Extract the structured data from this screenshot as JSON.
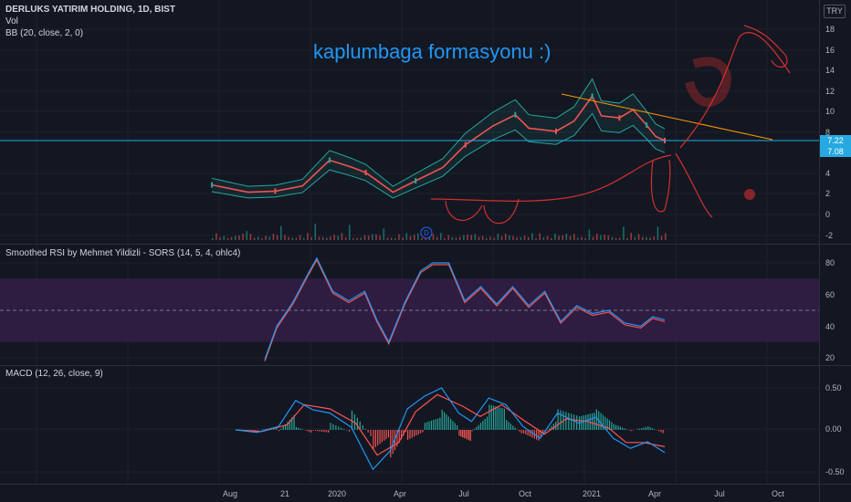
{
  "header": {
    "symbol_line": "DERLUKS YATIRIM HOLDING, 1D, BIST",
    "vol_label": "Vol",
    "bb_label": "BB (20, close, 2, 0)",
    "currency": "TRY"
  },
  "annotation_text": "kaplumbaga formasyonu :)",
  "price_tags": [
    "7.22",
    "7.08"
  ],
  "rsi_title": "Smoothed RSI by Mehmet Yildizli - SORS (14, 5, 4, ohlc4)",
  "macd_title": "MACD (12, 26, close, 9)",
  "event_marker": "D",
  "colors": {
    "background": "#131722",
    "up": "#26a69a",
    "down": "#ef5350",
    "bb_band": "#26a69a",
    "rsi_zone": "#3b1f4e",
    "macd_line": "#2196f3",
    "signal_line": "#ff5252",
    "drawing": "#d32f2f",
    "trendline": "#ff9800",
    "price_line": "#26a9e1"
  },
  "chart_data": [
    {
      "type": "line",
      "title": "DERLUKS YATIRIM HOLDING, 1D, BIST",
      "x": [
        "Aug",
        "21",
        "2020",
        "Apr",
        "Jul",
        "Oct",
        "2021",
        "Apr",
        "Jul",
        "Oct"
      ],
      "y_ticks": [
        18,
        16,
        14,
        12,
        10,
        8,
        4,
        2,
        0,
        -2
      ],
      "ylim": [
        -2.4,
        19
      ],
      "series": [
        {
          "name": "Price",
          "values": [
            {
              "t": 0.0,
              "v": 2.9
            },
            {
              "t": 0.08,
              "v": 2.2
            },
            {
              "t": 0.14,
              "v": 2.3
            },
            {
              "t": 0.2,
              "v": 2.8
            },
            {
              "t": 0.26,
              "v": 5.3
            },
            {
              "t": 0.31,
              "v": 4.6
            },
            {
              "t": 0.34,
              "v": 4.1
            },
            {
              "t": 0.4,
              "v": 2.2
            },
            {
              "t": 0.45,
              "v": 3.3
            },
            {
              "t": 0.51,
              "v": 4.6
            },
            {
              "t": 0.56,
              "v": 6.8
            },
            {
              "t": 0.62,
              "v": 8.6
            },
            {
              "t": 0.67,
              "v": 9.7
            },
            {
              "t": 0.7,
              "v": 8.4
            },
            {
              "t": 0.76,
              "v": 8.1
            },
            {
              "t": 0.8,
              "v": 9.1
            },
            {
              "t": 0.84,
              "v": 11.5
            },
            {
              "t": 0.86,
              "v": 9.6
            },
            {
              "t": 0.9,
              "v": 9.4
            },
            {
              "t": 0.93,
              "v": 10.2
            },
            {
              "t": 0.96,
              "v": 8.7
            },
            {
              "t": 0.98,
              "v": 7.6
            },
            {
              "t": 1.0,
              "v": 7.2
            }
          ]
        }
      ]
    },
    {
      "type": "line",
      "title": "Smoothed RSI by Mehmet Yildizli - SORS (14, 5, 4, ohlc4)",
      "y_ticks": [
        80,
        60,
        40,
        20
      ],
      "ylim": [
        18,
        85
      ],
      "zone": [
        30,
        70
      ],
      "midline": 50,
      "series": [
        {
          "name": "RSI",
          "values": [
            {
              "t": 0.0,
              "v": 19
            },
            {
              "t": 0.03,
              "v": 40
            },
            {
              "t": 0.07,
              "v": 55
            },
            {
              "t": 0.11,
              "v": 74
            },
            {
              "t": 0.13,
              "v": 83
            },
            {
              "t": 0.17,
              "v": 62
            },
            {
              "t": 0.21,
              "v": 56
            },
            {
              "t": 0.25,
              "v": 62
            },
            {
              "t": 0.28,
              "v": 44
            },
            {
              "t": 0.31,
              "v": 30
            },
            {
              "t": 0.35,
              "v": 55
            },
            {
              "t": 0.39,
              "v": 75
            },
            {
              "t": 0.42,
              "v": 80
            },
            {
              "t": 0.46,
              "v": 80
            },
            {
              "t": 0.5,
              "v": 56
            },
            {
              "t": 0.54,
              "v": 65
            },
            {
              "t": 0.58,
              "v": 54
            },
            {
              "t": 0.62,
              "v": 65
            },
            {
              "t": 0.66,
              "v": 53
            },
            {
              "t": 0.7,
              "v": 62
            },
            {
              "t": 0.74,
              "v": 43
            },
            {
              "t": 0.78,
              "v": 53
            },
            {
              "t": 0.82,
              "v": 48
            },
            {
              "t": 0.86,
              "v": 50
            },
            {
              "t": 0.9,
              "v": 42
            },
            {
              "t": 0.94,
              "v": 40
            },
            {
              "t": 0.97,
              "v": 46
            },
            {
              "t": 1.0,
              "v": 44
            }
          ]
        }
      ]
    },
    {
      "type": "line",
      "title": "MACD (12, 26, close, 9)",
      "y_ticks": [
        0.5,
        0.0,
        -0.5
      ],
      "y_tick_labels": [
        "0.50",
        "0.00",
        "-0.50"
      ],
      "ylim": [
        -0.55,
        0.62
      ],
      "series": [
        {
          "name": "MACD",
          "values": [
            {
              "t": 0.0,
              "v": 0.0
            },
            {
              "t": 0.05,
              "v": -0.03
            },
            {
              "t": 0.1,
              "v": 0.04
            },
            {
              "t": 0.14,
              "v": 0.35
            },
            {
              "t": 0.18,
              "v": 0.24
            },
            {
              "t": 0.22,
              "v": 0.2
            },
            {
              "t": 0.27,
              "v": 0.03
            },
            {
              "t": 0.32,
              "v": -0.47
            },
            {
              "t": 0.36,
              "v": -0.25
            },
            {
              "t": 0.4,
              "v": 0.25
            },
            {
              "t": 0.44,
              "v": 0.4
            },
            {
              "t": 0.48,
              "v": 0.5
            },
            {
              "t": 0.52,
              "v": 0.2
            },
            {
              "t": 0.55,
              "v": 0.1
            },
            {
              "t": 0.59,
              "v": 0.38
            },
            {
              "t": 0.63,
              "v": 0.3
            },
            {
              "t": 0.67,
              "v": 0.04
            },
            {
              "t": 0.71,
              "v": -0.1
            },
            {
              "t": 0.75,
              "v": 0.2
            },
            {
              "t": 0.8,
              "v": 0.08
            },
            {
              "t": 0.84,
              "v": 0.15
            },
            {
              "t": 0.88,
              "v": -0.1
            },
            {
              "t": 0.92,
              "v": -0.22
            },
            {
              "t": 0.96,
              "v": -0.14
            },
            {
              "t": 1.0,
              "v": -0.27
            }
          ]
        },
        {
          "name": "Signal",
          "values": [
            {
              "t": 0.0,
              "v": 0.0
            },
            {
              "t": 0.06,
              "v": -0.02
            },
            {
              "t": 0.12,
              "v": 0.06
            },
            {
              "t": 0.16,
              "v": 0.3
            },
            {
              "t": 0.22,
              "v": 0.25
            },
            {
              "t": 0.28,
              "v": 0.08
            },
            {
              "t": 0.33,
              "v": -0.3
            },
            {
              "t": 0.38,
              "v": -0.15
            },
            {
              "t": 0.42,
              "v": 0.22
            },
            {
              "t": 0.47,
              "v": 0.42
            },
            {
              "t": 0.53,
              "v": 0.28
            },
            {
              "t": 0.57,
              "v": 0.16
            },
            {
              "t": 0.62,
              "v": 0.3
            },
            {
              "t": 0.67,
              "v": 0.12
            },
            {
              "t": 0.72,
              "v": -0.05
            },
            {
              "t": 0.77,
              "v": 0.13
            },
            {
              "t": 0.82,
              "v": 0.1
            },
            {
              "t": 0.87,
              "v": 0.02
            },
            {
              "t": 0.91,
              "v": -0.15
            },
            {
              "t": 0.95,
              "v": -0.15
            },
            {
              "t": 1.0,
              "v": -0.2
            }
          ]
        }
      ]
    }
  ]
}
